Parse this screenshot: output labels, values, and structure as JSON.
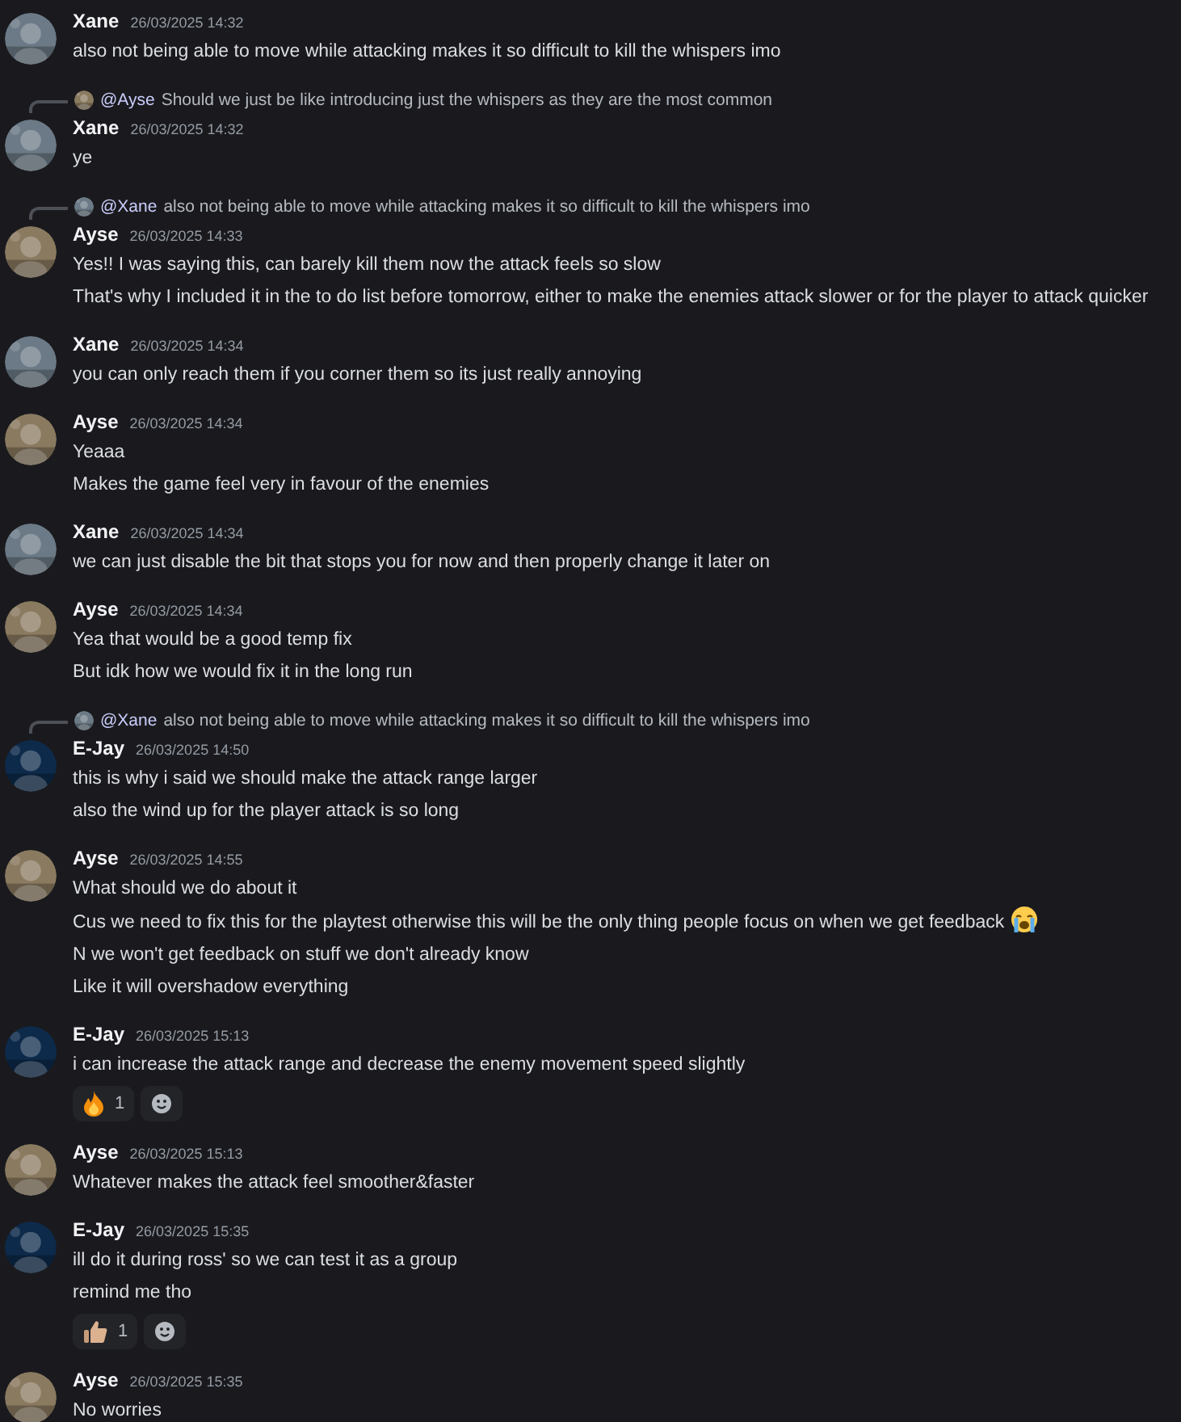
{
  "messages": [
    {
      "author": "Xane",
      "timestamp": "26/03/2025 14:32",
      "avatar": {
        "color": "#6b7a86"
      },
      "lines": [
        {
          "text": "also not being able to move while attacking makes it so difficult to kill the whispers imo"
        }
      ]
    },
    {
      "author": "Xane",
      "timestamp": "26/03/2025 14:32",
      "avatar": {
        "color": "#6b7a86"
      },
      "reply": {
        "mention": "@Ayse",
        "text": "Should we just be like introducing just the whispers as they are the most common",
        "color": "#8a7a60"
      },
      "lines": [
        {
          "text": "ye"
        }
      ]
    },
    {
      "author": "Ayse",
      "timestamp": "26/03/2025 14:33",
      "avatar": {
        "color": "#8a7a60"
      },
      "reply": {
        "mention": "@Xane",
        "text": "also not being able to move while attacking makes it so difficult to kill the whispers imo",
        "color": "#6b7a86"
      },
      "lines": [
        {
          "text": "Yes!! I was saying this, can barely kill them now the attack feels so slow"
        },
        {
          "text": "That's why I included it in the to do list before tomorrow, either to make the enemies attack slower or for the player to attack quicker"
        }
      ]
    },
    {
      "author": "Xane",
      "timestamp": "26/03/2025 14:34",
      "avatar": {
        "color": "#6b7a86"
      },
      "lines": [
        {
          "text": "you can only reach them if you corner them so its just really annoying"
        }
      ]
    },
    {
      "author": "Ayse",
      "timestamp": "26/03/2025 14:34",
      "avatar": {
        "color": "#8a7a60"
      },
      "lines": [
        {
          "text": "Yeaaa"
        },
        {
          "text": "Makes the game feel very in favour of the enemies"
        }
      ]
    },
    {
      "author": "Xane",
      "timestamp": "26/03/2025 14:34",
      "avatar": {
        "color": "#6b7a86"
      },
      "lines": [
        {
          "text": "we can just disable the bit that stops you for now and then properly change it later on"
        }
      ]
    },
    {
      "author": "Ayse",
      "timestamp": "26/03/2025 14:34",
      "avatar": {
        "color": "#8a7a60"
      },
      "lines": [
        {
          "text": "Yea that would be a good temp fix"
        },
        {
          "text": "But idk how we would fix it in the long run"
        }
      ]
    },
    {
      "author": "E-Jay",
      "timestamp": "26/03/2025 14:50",
      "avatar": {
        "color": "#0d2a4a"
      },
      "reply": {
        "mention": "@Xane",
        "text": "also not being able to move while attacking makes it so difficult to kill the whispers imo",
        "color": "#6b7a86"
      },
      "lines": [
        {
          "text": "this is why i said we should make the attack range larger"
        },
        {
          "text": "also the wind up for the player attack is so long"
        }
      ]
    },
    {
      "author": "Ayse",
      "timestamp": "26/03/2025 14:55",
      "avatar": {
        "color": "#8a7a60"
      },
      "lines": [
        {
          "text": "What should we do about it"
        },
        {
          "text": "Cus we need to fix this for the playtest otherwise this will be the only thing people focus on when we get feedback",
          "kind": "with-emoji"
        },
        {
          "text": "N we won't get feedback on stuff we don't already know"
        },
        {
          "text": "Like it will overshadow everything"
        }
      ]
    },
    {
      "author": "E-Jay",
      "timestamp": "26/03/2025 15:13",
      "avatar": {
        "color": "#0d2a4a"
      },
      "lines": [
        {
          "text": "i can increase the attack range and decrease the enemy movement speed slightly"
        }
      ],
      "reactions": [
        {
          "kind": "fire",
          "count": "1"
        }
      ]
    },
    {
      "author": "Ayse",
      "timestamp": "26/03/2025 15:13",
      "avatar": {
        "color": "#8a7a60"
      },
      "lines": [
        {
          "text": "Whatever makes the attack feel smoother&faster"
        }
      ]
    },
    {
      "author": "E-Jay",
      "timestamp": "26/03/2025 15:35",
      "avatar": {
        "color": "#0d2a4a"
      },
      "lines": [
        {
          "text": "ill do it during ross' so we can test it as a group"
        },
        {
          "text": "remind me tho"
        }
      ],
      "reactions": [
        {
          "kind": "thumbs-up",
          "count": "1"
        }
      ]
    },
    {
      "author": "Ayse",
      "timestamp": "26/03/2025 15:35",
      "avatar": {
        "color": "#8a7a60"
      },
      "lines": [
        {
          "text": "No worries"
        }
      ]
    }
  ]
}
